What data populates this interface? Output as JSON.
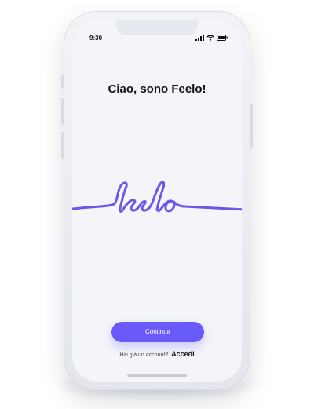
{
  "status_bar": {
    "time": "9:30"
  },
  "screen": {
    "greeting": "Ciao, sono Feelo!",
    "logo_text": "feelo",
    "continue_label": "Continua",
    "account_prompt": "Hai già un account?",
    "login_label": "Accedi"
  },
  "colors": {
    "accent": "#6a5af9",
    "logo_stroke": "#6b58e8",
    "screen_background": "#f3f5f9"
  },
  "icons": {
    "signal": "cellular-signal-icon",
    "wifi": "wifi-icon",
    "battery": "battery-icon"
  }
}
